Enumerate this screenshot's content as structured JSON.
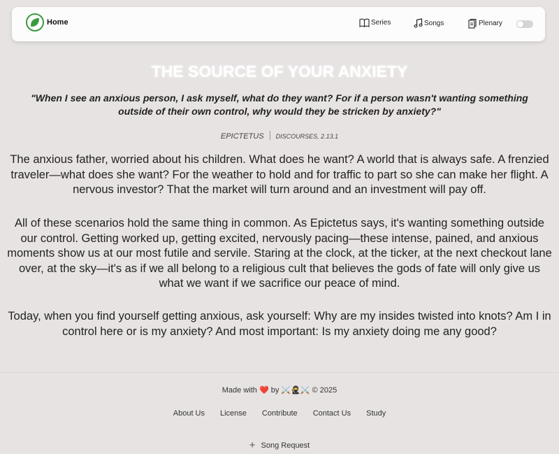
{
  "nav": {
    "brand_label": "Home",
    "series_label": "Series",
    "songs_label": "Songs",
    "plenary_label": "Plenary",
    "theme_toggle_on": false
  },
  "article": {
    "title": "THE SOURCE OF YOUR ANXIETY",
    "quote": "\"When I see an anxious person, I ask myself, what do they want? For if a person wasn't wanting something outside of their own control, why would they be stricken by anxiety?\"",
    "author": "EPICTETUS",
    "source": "DISCOURSES, 2.13.1",
    "paragraphs": [
      "The anxious father, worried about his children. What does he want? A world that is always safe. A frenzied traveler—what does she want? For the weather to hold and for traffic to part so she can make her flight. A nervous investor? That the market will turn around and an investment will pay off.",
      "All of these scenarios hold the same thing in common. As Epictetus says, it's wanting something outside our control. Getting worked up, getting excited, nervously pacing—these intense, pained, and anxious moments show us at our most futile and servile. Staring at the clock, at the ticker, at the next checkout lane over, at the sky—it's as if we all belong to a religious cult that believes the gods of fate will only give us what we want if we sacrifice our peace of mind.",
      "Today, when you find yourself getting anxious, ask yourself: Why are my insides twisted into knots? Am I in control here or is my anxiety? And most important: Is my anxiety doing me any good?"
    ]
  },
  "footer": {
    "made_with_prefix": "Made with",
    "heart": "❤️",
    "by": "by",
    "emblem": "⚔️🥷⚔️",
    "copyright": "© 2025",
    "links": [
      "About Us",
      "License",
      "Contribute",
      "Contact Us",
      "Study"
    ],
    "song_request_label": "Song Request"
  },
  "colors": {
    "background": "#e8e3e3",
    "logo_green": "#3a9a3f",
    "heart_red": "#e02b2b"
  }
}
